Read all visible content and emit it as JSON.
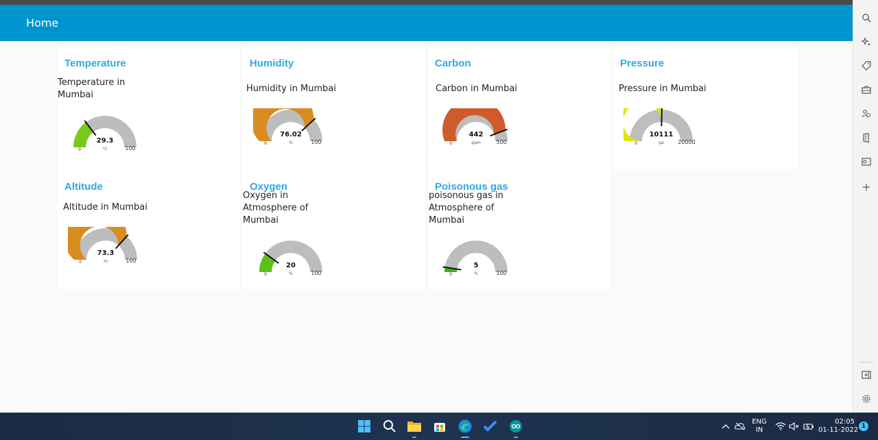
{
  "header": {
    "title": "Home"
  },
  "cards": [
    {
      "title": "Temperature",
      "subtitle": "Temperature in Mumbai",
      "value": "29.3",
      "unit": "°C",
      "min": "0",
      "max": "100",
      "fraction": 0.293,
      "color": "#78c91e"
    },
    {
      "title": "Humidity",
      "subtitle": "Humidity in Mumbai",
      "value": "76.02",
      "unit": "%",
      "min": "0",
      "max": "100",
      "fraction": 0.7602,
      "color": "#d98c1f"
    },
    {
      "title": "Carbon",
      "subtitle": "Carbon in Mumbai",
      "value": "442",
      "unit": "ppm",
      "min": "0",
      "max": "500",
      "fraction": 0.884,
      "color": "#cf5a2a"
    },
    {
      "title": "Pressure",
      "subtitle": "Pressure in Mumbai",
      "value": "10111",
      "unit": "pa",
      "min": "0",
      "max": "20000",
      "fraction": 0.50555,
      "color": "#e3e30b"
    },
    {
      "title": "Altitude",
      "subtitle": "Altitude in Mumbai",
      "value": "73.3",
      "unit": "m",
      "min": "0",
      "max": "100",
      "fraction": 0.733,
      "color": "#d98c1f"
    },
    {
      "title": "Oxygen",
      "subtitle": "Oxygen in Atmosphere of Mumbai",
      "value": "20",
      "unit": "%",
      "min": "0",
      "max": "100",
      "fraction": 0.2,
      "color": "#5cc01a"
    },
    {
      "title": "Poisonous gas",
      "subtitle": "poisonous gas in Atmosphere of Mumbai",
      "value": "5",
      "unit": "%",
      "min": "0",
      "max": "100",
      "fraction": 0.05,
      "color": "#3cb01a"
    }
  ],
  "colors": {
    "header": "#0094ce",
    "title": "#2eaae0",
    "track": "#bdbdbd"
  },
  "sidebar": {
    "icons": [
      "search-icon",
      "sparkle-icon",
      "tag-icon",
      "toolbox-icon",
      "people-icon",
      "office-icon",
      "outlook-icon",
      "plus-icon",
      "split-screen-icon",
      "gear-icon"
    ]
  },
  "taskbar": {
    "apps": [
      "windows-start-icon",
      "search-icon",
      "file-explorer-icon",
      "store-icon",
      "edge-icon",
      "todo-icon",
      "arduino-icon"
    ],
    "lang_1": "ENG",
    "lang_2": "IN",
    "time": "02:05",
    "date": "01-11-2022",
    "notifications": "1"
  }
}
